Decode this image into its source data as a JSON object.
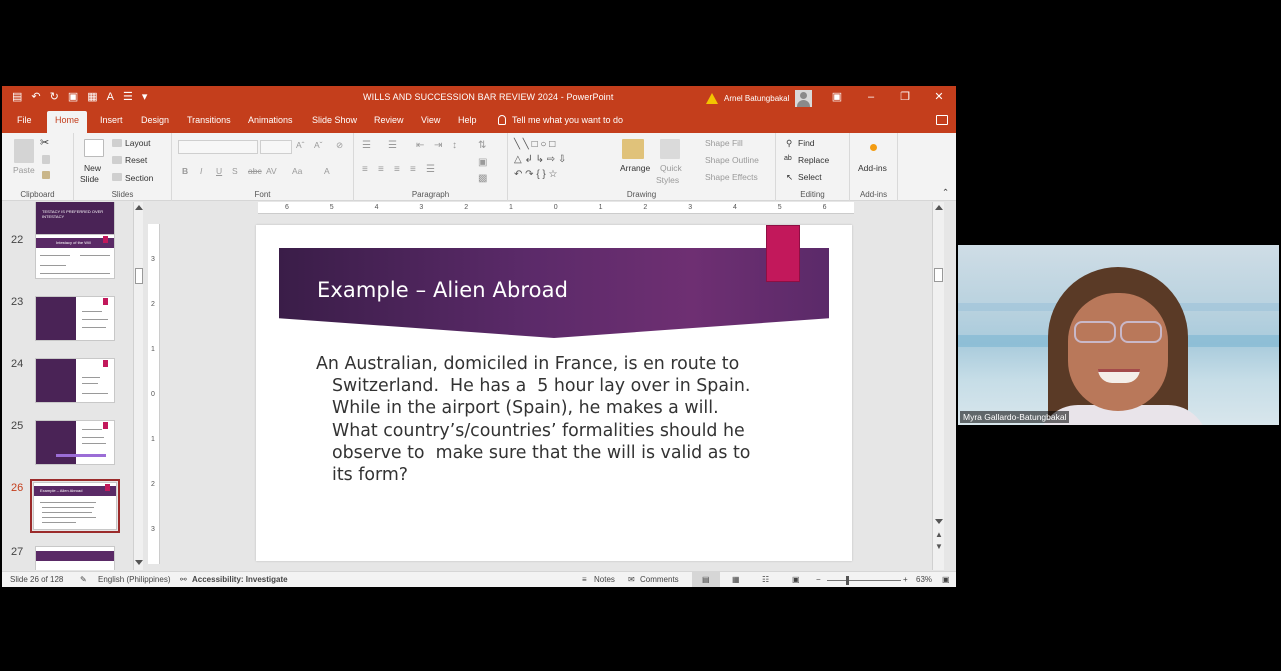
{
  "window": {
    "title": "WILLS AND SUCCESSION BAR REVIEW 2024  -  PowerPoint",
    "user": "Arnel Batungbakal"
  },
  "tabs": [
    "File",
    "Home",
    "Insert",
    "Design",
    "Transitions",
    "Animations",
    "Slide Show",
    "Review",
    "View",
    "Help"
  ],
  "tell_me": "Tell me what you want to do",
  "ribbon": {
    "clipboard": {
      "label": "Clipboard",
      "paste": "Paste"
    },
    "slides": {
      "label": "Slides",
      "new_slide": "New",
      "new_slide2": "Slide",
      "layout": "Layout",
      "reset": "Reset",
      "section": "Section"
    },
    "font": {
      "label": "Font"
    },
    "paragraph": {
      "label": "Paragraph"
    },
    "drawing": {
      "label": "Drawing",
      "arrange": "Arrange",
      "quick_styles": "Quick",
      "quick_styles2": "Styles",
      "shape_fill": "Shape Fill",
      "shape_outline": "Shape Outline",
      "shape_effects": "Shape Effects"
    },
    "editing": {
      "label": "Editing",
      "find": "Find",
      "replace": "Replace",
      "select": "Select"
    },
    "addins": {
      "label": "Add-ins",
      "button": "Add-ins"
    }
  },
  "thumbnails": [
    {
      "num": "",
      "title": "TESTACY IS PREFERRED OVER INTESTACY"
    },
    {
      "num": "22",
      "title": "Intestacy of the Will"
    },
    {
      "num": "23",
      "title": ""
    },
    {
      "num": "24",
      "title": ""
    },
    {
      "num": "25",
      "title": ""
    },
    {
      "num": "26",
      "title": "Example – Alien Abroad"
    },
    {
      "num": "27",
      "title": ""
    }
  ],
  "ruler": {
    "h": [
      "6",
      "5",
      "4",
      "3",
      "2",
      "1",
      "0",
      "1",
      "2",
      "3",
      "4",
      "5",
      "6"
    ],
    "v": [
      "3",
      "2",
      "1",
      "0",
      "1",
      "2",
      "3"
    ]
  },
  "slide": {
    "title": "Example – Alien Abroad",
    "body": "An Australian, domiciled in France, is en route to Switzerland.  He has a  5 hour lay over in Spain.  While in the airport (Spain), he makes a will.  What country’s/countries’ formalities should he observe to  make sure that the will is valid as to its form?"
  },
  "status": {
    "slide_count": "Slide 26 of 128",
    "language": "English (Philippines)",
    "accessibility": "Accessibility: Investigate",
    "notes": "Notes",
    "comments": "Comments",
    "zoom": "63%"
  },
  "video": {
    "name": "Myra Gallardo-Batungbakal"
  }
}
